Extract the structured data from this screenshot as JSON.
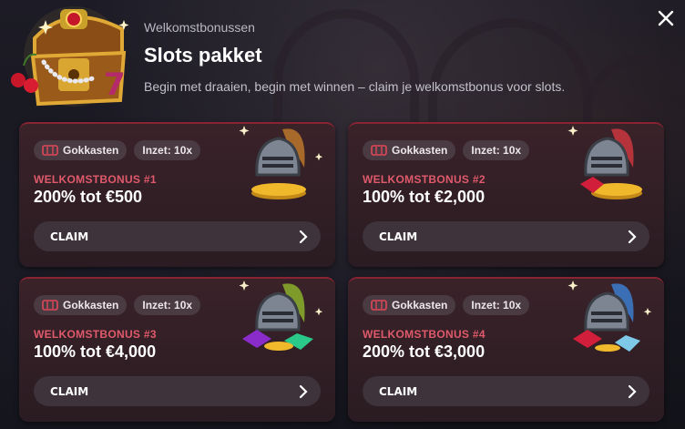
{
  "header": {
    "subtitle": "Welkomstbonussen",
    "title": "Slots pakket",
    "description": "Begin met draaien, begin met winnen – claim je welkomstbonus voor slots."
  },
  "tag_games": "Gokkasten",
  "tag_wager": "Inzet: 10x",
  "claim_label": "CLAIM",
  "cards": [
    {
      "label": "WELKOMSTBONUS #1",
      "amount": "200% tot €500",
      "plume": "#a86a2a"
    },
    {
      "label": "WELKOMSTBONUS #2",
      "amount": "100% tot €2,000",
      "plume": "#b5333b"
    },
    {
      "label": "WELKOMSTBONUS #3",
      "amount": "100% tot €4,000",
      "plume": "#7d9a2a"
    },
    {
      "label": "WELKOMSTBONUS #4",
      "amount": "200% tot €3,000",
      "plume": "#3b6fb5"
    }
  ],
  "colors": {
    "accent": "#e05a6b",
    "card_border": "#8a2332"
  }
}
